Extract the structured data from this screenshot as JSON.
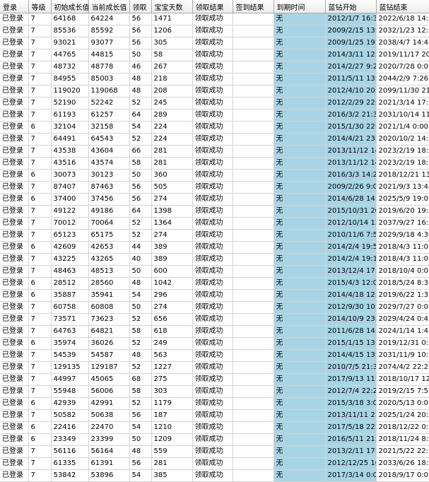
{
  "columns": [
    "登录",
    "等级",
    "初始成长值",
    "当前成长值",
    "领取",
    "宝宝天数",
    "领取结果",
    "签到结果",
    "到期时间",
    "蓝钻开始",
    "蓝钻结束"
  ],
  "rows": [
    [
      "已登录",
      "7",
      "64168",
      "64224",
      "56",
      "1471",
      "领取成功",
      "",
      "无",
      "2012/1/7 16:3...",
      "2022/6/18 14:..."
    ],
    [
      "已登录",
      "7",
      "85536",
      "85592",
      "56",
      "1206",
      "领取成功",
      "",
      "无",
      "2009/2/15 13:...",
      "2032/1/23 12:..."
    ],
    [
      "已登录",
      "7",
      "93021",
      "93077",
      "56",
      "305",
      "领取成功",
      "",
      "无",
      "2009/1/25 19:4...",
      "2038/4/7 14:4..."
    ],
    [
      "已登录",
      "7",
      "44765",
      "44815",
      "50",
      "58",
      "领取成功",
      "",
      "无",
      "2014/3/11 12:...",
      "2019/11/17 20:..."
    ],
    [
      "已登录",
      "7",
      "48732",
      "48778",
      "46",
      "267",
      "领取成功",
      "",
      "无",
      "2014/2/27 9:2...",
      "2020/7/28 0:0..."
    ],
    [
      "已登录",
      "7",
      "84955",
      "85003",
      "48",
      "218",
      "领取成功",
      "",
      "无",
      "2011/5/11 13:...",
      "2044/2/9 7:26:..."
    ],
    [
      "已登录",
      "7",
      "119020",
      "119068",
      "48",
      "208",
      "领取成功",
      "",
      "无",
      "2012/4/10 20:...",
      "2099/11/30 21:..."
    ],
    [
      "已登录",
      "7",
      "52190",
      "52242",
      "52",
      "245",
      "领取成功",
      "",
      "无",
      "2012/2/29 22:...",
      "2021/3/14 17:..."
    ],
    [
      "已登录",
      "7",
      "61193",
      "61257",
      "64",
      "289",
      "领取成功",
      "",
      "无",
      "2016/3/2 21:3...",
      "2031/10/14 11:..."
    ],
    [
      "已登录",
      "6",
      "32104",
      "32158",
      "54",
      "224",
      "领取成功",
      "",
      "无",
      "2015/1/30 22:...",
      "2021/1/4 0:00:..."
    ],
    [
      "已登录",
      "7",
      "64491",
      "64543",
      "52",
      "224",
      "领取成功",
      "",
      "无",
      "2014/4/21 23:...",
      "2020/10/2 14:..."
    ],
    [
      "已登录",
      "7",
      "43538",
      "43604",
      "66",
      "281",
      "领取成功",
      "",
      "无",
      "2013/11/12 14:...",
      "2023/2/19 18:..."
    ],
    [
      "已登录",
      "7",
      "43516",
      "43574",
      "58",
      "281",
      "领取成功",
      "",
      "无",
      "2013/11/12 14:...",
      "2023/2/19 18:..."
    ],
    [
      "已登录",
      "6",
      "30073",
      "30123",
      "50",
      "360",
      "领取成功",
      "",
      "无",
      "2016/3/3 14:2...",
      "2018/12/21 13:..."
    ],
    [
      "已登录",
      "7",
      "87407",
      "87463",
      "56",
      "505",
      "领取成功",
      "",
      "无",
      "2009/2/26 9:0...",
      "2021/9/3 13:4..."
    ],
    [
      "已登录",
      "6",
      "37400",
      "37456",
      "56",
      "274",
      "领取成功",
      "",
      "无",
      "2014/6/28 14:...",
      "2025/5/9 19:0..."
    ],
    [
      "已登录",
      "7",
      "49122",
      "49186",
      "64",
      "1398",
      "领取成功",
      "",
      "无",
      "2015/10/31 20:...",
      "2019/6/20 19:..."
    ],
    [
      "已登录",
      "7",
      "70012",
      "70064",
      "52",
      "1364",
      "领取成功",
      "",
      "无",
      "2012/10/14 13:...",
      "2037/9/27 16:..."
    ],
    [
      "已登录",
      "7",
      "65123",
      "65175",
      "52",
      "274",
      "领取成功",
      "",
      "无",
      "2010/11/6 7:5...",
      "2029/9/18 4:3..."
    ],
    [
      "已登录",
      "6",
      "42609",
      "42653",
      "44",
      "389",
      "领取成功",
      "",
      "无",
      "2014/2/4 19:5...",
      "2018/4/3 11:0..."
    ],
    [
      "已登录",
      "7",
      "43225",
      "43265",
      "40",
      "389",
      "领取成功",
      "",
      "无",
      "2014/2/4 19:1...",
      "2018/4/3 11:0..."
    ],
    [
      "已登录",
      "7",
      "48463",
      "48513",
      "50",
      "600",
      "领取成功",
      "",
      "无",
      "2013/12/4 17:...",
      "2018/10/4 0:0..."
    ],
    [
      "已登录",
      "6",
      "28512",
      "28560",
      "48",
      "1042",
      "领取成功",
      "",
      "无",
      "2015/4/3 12:0...",
      "2018/5/24 8:3..."
    ],
    [
      "已登录",
      "6",
      "35887",
      "35941",
      "54",
      "296",
      "领取成功",
      "",
      "无",
      "2014/4/18 12:...",
      "2019/6/22 1:3..."
    ],
    [
      "已登录",
      "7",
      "60758",
      "60808",
      "50",
      "274",
      "领取成功",
      "",
      "无",
      "2012/9/30 10:...",
      "2029/7/27 0:0..."
    ],
    [
      "已登录",
      "7",
      "73571",
      "73623",
      "52",
      "656",
      "领取成功",
      "",
      "无",
      "2014/10/9 23:...",
      "2029/4/24 0:4..."
    ],
    [
      "已登录",
      "7",
      "64763",
      "64821",
      "58",
      "618",
      "领取成功",
      "",
      "无",
      "2011/6/28 14:...",
      "2024/1/14 1:4..."
    ],
    [
      "已登录",
      "6",
      "35974",
      "36026",
      "52",
      "249",
      "领取成功",
      "",
      "无",
      "2015/1/15 13:...",
      "2019/12/31 0:..."
    ],
    [
      "已登录",
      "7",
      "54539",
      "54587",
      "48",
      "563",
      "领取成功",
      "",
      "无",
      "2014/4/15 13:...",
      "2031/11/9 10:..."
    ],
    [
      "已登录",
      "7",
      "129135",
      "129187",
      "52",
      "1227",
      "领取成功",
      "",
      "无",
      "2010/7/5 21:3...",
      "2074/4/2 22:2..."
    ],
    [
      "已登录",
      "7",
      "44997",
      "45065",
      "68",
      "275",
      "领取成功",
      "",
      "无",
      "2017/9/13 11:...",
      "2018/10/17 12:..."
    ],
    [
      "已登录",
      "7",
      "55948",
      "56006",
      "58",
      "303",
      "领取成功",
      "",
      "无",
      "2012/7/4 22:2...",
      "2019/2/15 7:5..."
    ],
    [
      "已登录",
      "6",
      "42939",
      "42991",
      "52",
      "1179",
      "领取成功",
      "",
      "无",
      "2015/3/18 3:0...",
      "2020/5/13 0:0..."
    ],
    [
      "已登录",
      "7",
      "50582",
      "50638",
      "56",
      "187",
      "领取成功",
      "",
      "无",
      "2013/11/11 21:...",
      "2025/1/24 20:..."
    ],
    [
      "已登录",
      "6",
      "22416",
      "22470",
      "54",
      "1210",
      "领取成功",
      "",
      "无",
      "2017/5/18 22:...",
      "2018/12/22 0:..."
    ],
    [
      "已登录",
      "6",
      "23349",
      "23399",
      "50",
      "1209",
      "领取成功",
      "",
      "无",
      "2016/5/11 21:...",
      "2018/11/24 8:..."
    ],
    [
      "已登录",
      "7",
      "56116",
      "56164",
      "48",
      "559",
      "领取成功",
      "",
      "无",
      "2013/2/11 17:...",
      "2021/5/22 22:..."
    ],
    [
      "已登录",
      "7",
      "61335",
      "61391",
      "56",
      "281",
      "领取成功",
      "",
      "无",
      "2012/12/25 16:...",
      "2033/6/26 18:..."
    ],
    [
      "已登录",
      "7",
      "53842",
      "53896",
      "54",
      "385",
      "领取成功",
      "",
      "无",
      "2017/3/14 0:0...",
      "2018/9/17 0:0..."
    ]
  ]
}
